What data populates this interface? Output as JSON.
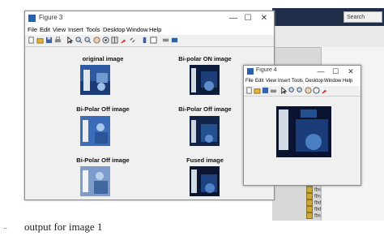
{
  "background_app": {
    "search_label": "Search",
    "files": [
      "fbd",
      "fbs",
      "fbs",
      "fbd",
      "fbd",
      "fbs"
    ]
  },
  "figure3": {
    "title": "Figure 3",
    "controls": [
      "—",
      "☐",
      "✕"
    ],
    "menu": [
      "File",
      "Edit",
      "View",
      "Insert",
      "Tools",
      "Desktop",
      "Window",
      "Help"
    ],
    "toolbar_icons": [
      "new-file-icon",
      "open-folder-icon",
      "save-icon",
      "print-icon",
      "pointer-icon",
      "zoom-in-icon",
      "zoom-out-icon",
      "pan-icon",
      "rotate-icon",
      "data-cursor-icon",
      "brush-icon",
      "link-icon",
      "colorbar-icon",
      "legend-icon",
      "grid-icon",
      "dock-icon"
    ],
    "panels": [
      {
        "label": "original image"
      },
      {
        "label": "Bi-polar ON image"
      },
      {
        "label": "Bi-Polar Off image"
      },
      {
        "label": "Bi-Polar Off image"
      },
      {
        "label": "Bi-Polar Off image"
      },
      {
        "label": "Fused image"
      }
    ]
  },
  "figure4": {
    "title": "Figure 4",
    "controls": [
      "—",
      "☐",
      "✕"
    ],
    "menu": [
      "File",
      "Edit",
      "View",
      "Insert",
      "Tools",
      "Desktop",
      "Window",
      "Help"
    ]
  },
  "caption": {
    "marker": "..",
    "text": "output for image 1"
  },
  "colors": {
    "taskbar": "#1f2d48",
    "window_bg": "#f0f0f0",
    "image_blue": "#2c5fa8"
  }
}
